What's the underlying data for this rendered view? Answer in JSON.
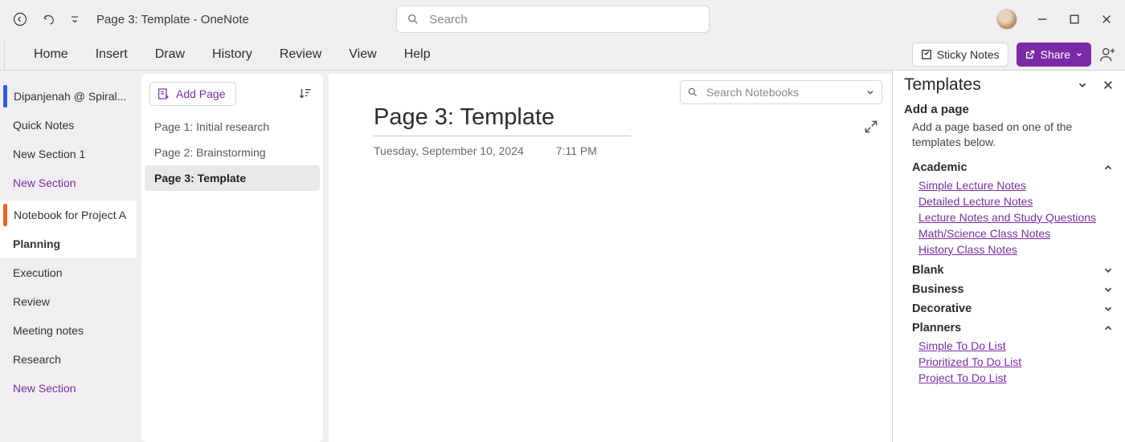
{
  "titlebar": {
    "doc_title": "Page 3: Template  -  OneNote",
    "search_placeholder": "Search"
  },
  "ribbon": {
    "tabs": [
      "Home",
      "Insert",
      "Draw",
      "History",
      "Review",
      "View",
      "Help"
    ],
    "sticky_label": "Sticky Notes",
    "share_label": "Share"
  },
  "nav": {
    "notebook1": "Dipanjenah @ Spiral...",
    "quick_notes": "Quick Notes",
    "new_section1": "New Section 1",
    "new_section_a": "New Section",
    "notebook2": "Notebook for Project A",
    "planning": "Planning",
    "execution": "Execution",
    "review": "Review",
    "meeting": "Meeting notes",
    "research": "Research",
    "new_section_b": "New Section"
  },
  "pages": {
    "add_label": "Add Page",
    "items": [
      {
        "label": "Page 1: Initial research"
      },
      {
        "label": "Page 2: Brainstorming"
      },
      {
        "label": "Page 3: Template"
      }
    ]
  },
  "editor": {
    "search_placeholder": "Search Notebooks",
    "title": "Page 3: Template",
    "date": "Tuesday, September 10, 2024",
    "time": "7:11 PM"
  },
  "templates": {
    "title": "Templates",
    "add_page": "Add a page",
    "helper": "Add a page based on one of the templates below.",
    "cat_academic": "Academic",
    "academic_links": {
      "a": "Simple Lecture Notes",
      "b": "Detailed Lecture Notes",
      "c": "Lecture Notes and Study Questions",
      "d": "Math/Science Class Notes",
      "e": "History Class Notes"
    },
    "cat_blank": "Blank",
    "cat_business": "Business",
    "cat_decorative": "Decorative",
    "cat_planners": "Planners",
    "planner_links": {
      "a": "Simple To Do List",
      "b": "Prioritized To Do List",
      "c": "Project To Do List"
    }
  }
}
